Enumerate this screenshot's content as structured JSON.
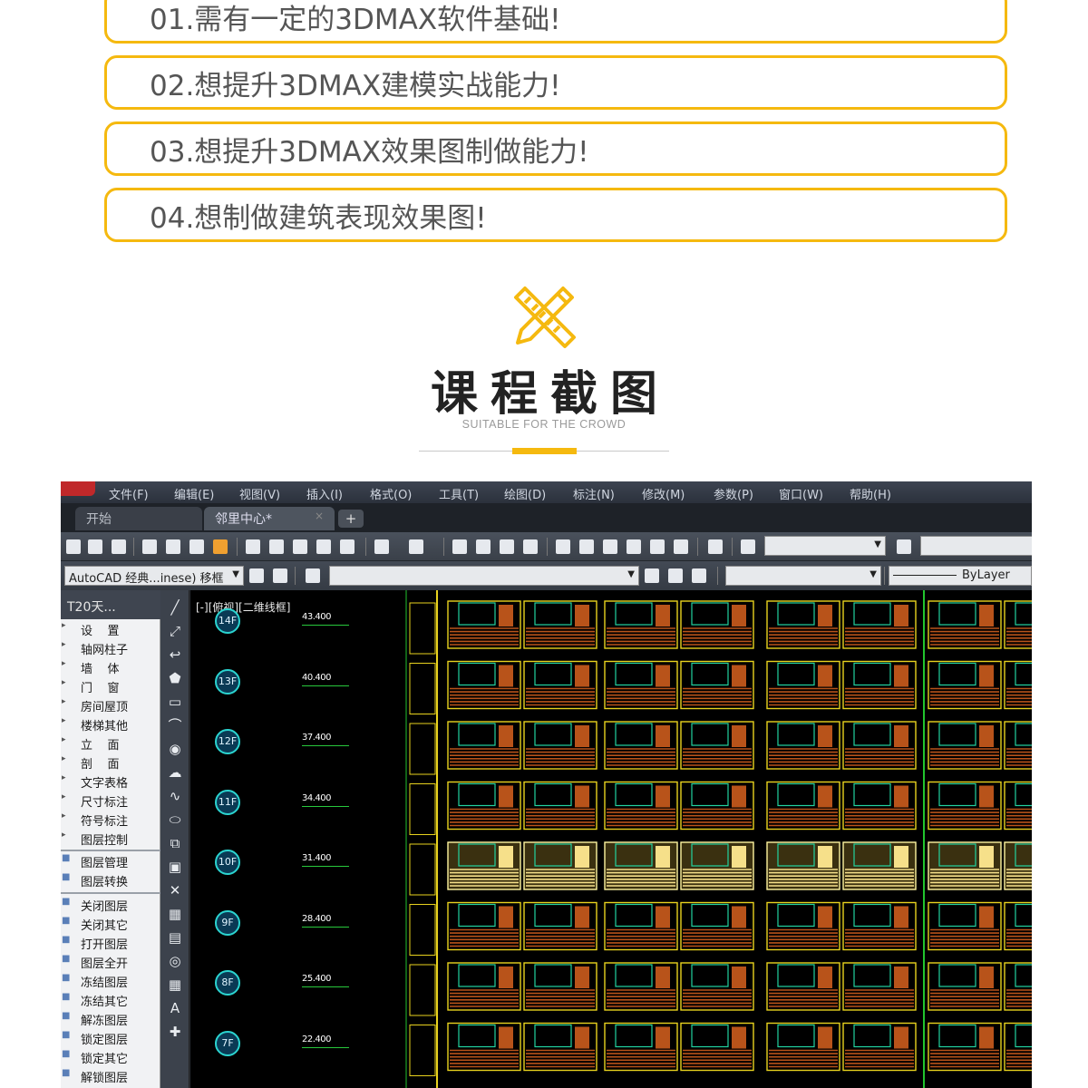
{
  "audience": [
    {
      "text": "01.需有一定的3DMAX软件基础!"
    },
    {
      "text": "02.想提升3DMAX建模实战能力!"
    },
    {
      "text": "03.想提升3DMAX效果图制做能力!"
    },
    {
      "text": "04.想制做建筑表现效果图!"
    }
  ],
  "section": {
    "title": "课程截图",
    "subtitle": "SUITABLE FOR THE CROWD",
    "icon": "pencil-ruler-icon",
    "accent_color": "#f5b90f"
  },
  "screenshot": {
    "menu": [
      "文件(F)",
      "编辑(E)",
      "视图(V)",
      "插入(I)",
      "格式(O)",
      "工具(T)",
      "绘图(D)",
      "标注(N)",
      "修改(M)",
      "参数(P)",
      "窗口(W)",
      "帮助(H)"
    ],
    "tabs": {
      "start": "开始",
      "document": "邻里中心*",
      "close": "×",
      "add": "+"
    },
    "workspace": "AutoCAD 经典...inese) 移框",
    "linetype": "ByLayer",
    "panel_title": "T20天...",
    "panel_items": [
      "设    置",
      "轴网柱子",
      "墙    体",
      "门    窗",
      "房间屋顶",
      "楼梯其他",
      "立    面",
      "剖    面",
      "文字表格",
      "尺寸标注",
      "符号标注",
      "图层控制"
    ],
    "panel_layer_items": [
      "图层管理",
      "图层转换"
    ],
    "panel_layer_ops": [
      "关闭图层",
      "关闭其它",
      "打开图层",
      "图层全开",
      "冻结图层",
      "冻结其它",
      "解冻图层",
      "锁定图层",
      "锁定其它",
      "解锁图层"
    ],
    "viewport_label": "[-][俯视][二维线框]",
    "floors": [
      {
        "label": "14F",
        "elevation": "43.400"
      },
      {
        "label": "13F",
        "elevation": "40.400"
      },
      {
        "label": "12F",
        "elevation": "37.400"
      },
      {
        "label": "11F",
        "elevation": "34.400"
      },
      {
        "label": "10F",
        "elevation": "31.400"
      },
      {
        "label": "9F",
        "elevation": "28.400"
      },
      {
        "label": "8F",
        "elevation": "25.400"
      },
      {
        "label": "7F",
        "elevation": "22.400"
      }
    ],
    "colors": {
      "frame": "#e8d21e",
      "slat": "#b8531a",
      "window": "#22d3a0",
      "axis": "#22c52e",
      "background": "#000000"
    }
  }
}
